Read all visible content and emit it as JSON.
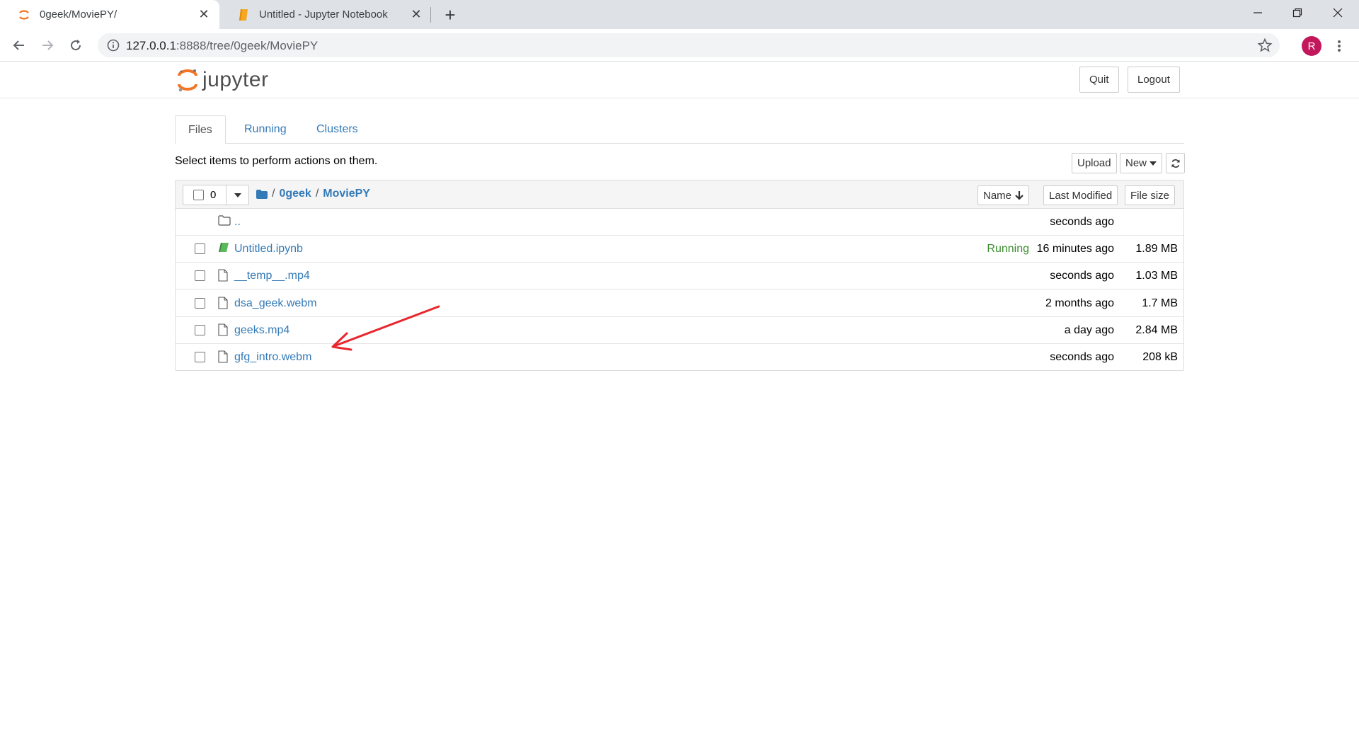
{
  "browser": {
    "tabs": [
      {
        "title": "0geek/MoviePY/",
        "active": true
      },
      {
        "title": "Untitled - Jupyter Notebook",
        "active": false
      }
    ],
    "url_host": "127.0.0.1",
    "url_path": ":8888/tree/0geek/MoviePY",
    "profile_initial": "R"
  },
  "header": {
    "logo_text": "jupyter",
    "quit_label": "Quit",
    "logout_label": "Logout"
  },
  "tabs": [
    {
      "label": "Files",
      "active": true
    },
    {
      "label": "Running",
      "active": false
    },
    {
      "label": "Clusters",
      "active": false
    }
  ],
  "toolbar": {
    "hint": "Select items to perform actions on them.",
    "upload_label": "Upload",
    "new_label": "New"
  },
  "list": {
    "selected_count": "0",
    "breadcrumb": [
      "0geek",
      "MoviePY"
    ],
    "sort_name_label": "Name",
    "sort_modified_label": "Last Modified",
    "sort_size_label": "File size",
    "rows": [
      {
        "name": "..",
        "type": "folder",
        "status": "",
        "modified": "seconds ago",
        "size": ""
      },
      {
        "name": "Untitled.ipynb",
        "type": "notebook",
        "status": "Running",
        "modified": "16 minutes ago",
        "size": "1.89 MB"
      },
      {
        "name": "__temp__.mp4",
        "type": "file",
        "status": "",
        "modified": "seconds ago",
        "size": "1.03 MB"
      },
      {
        "name": "dsa_geek.webm",
        "type": "file",
        "status": "",
        "modified": "2 months ago",
        "size": "1.7 MB"
      },
      {
        "name": "geeks.mp4",
        "type": "file",
        "status": "",
        "modified": "a day ago",
        "size": "2.84 MB"
      },
      {
        "name": "gfg_intro.webm",
        "type": "file",
        "status": "",
        "modified": "seconds ago",
        "size": "208 kB"
      }
    ]
  },
  "colors": {
    "link": "#337ab7",
    "running": "#3c8d2f",
    "jupyter_orange": "#f37626",
    "annotation_arrow": "#e8262d"
  }
}
